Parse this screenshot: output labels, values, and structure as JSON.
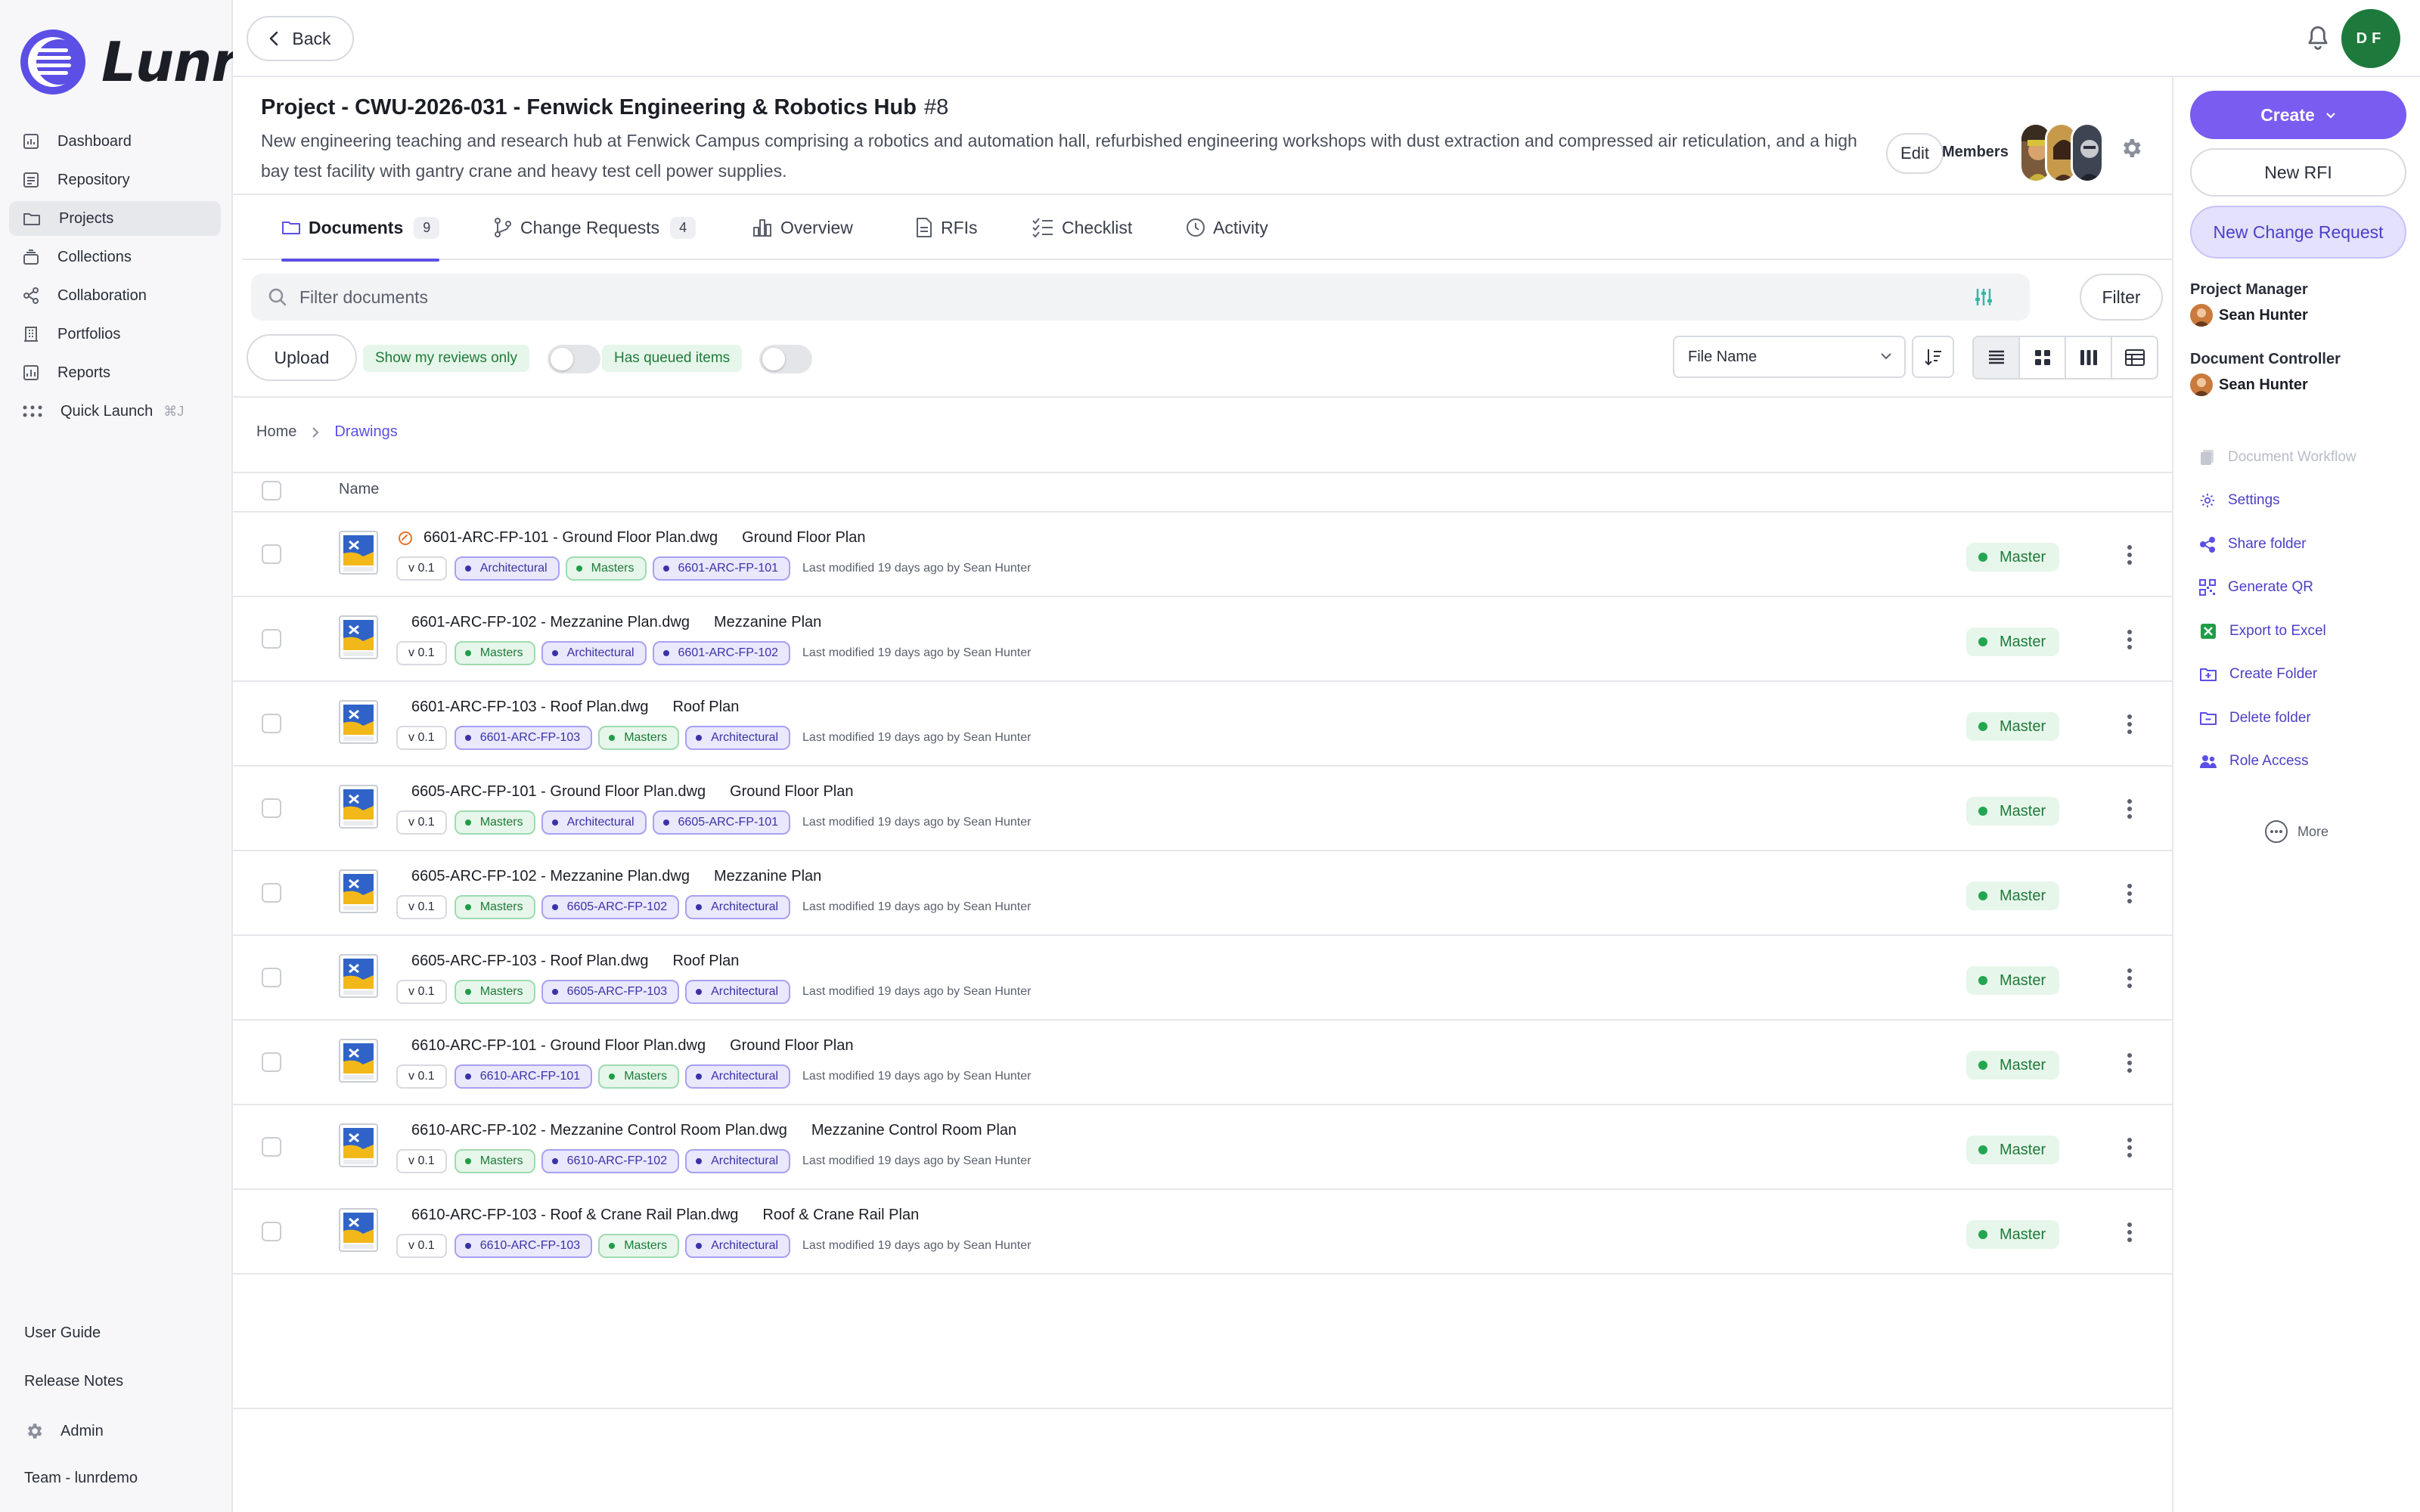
{
  "app": {
    "name": "Lunr"
  },
  "sidebar": {
    "items": [
      {
        "label": "Dashboard",
        "icon": "dashboard-icon"
      },
      {
        "label": "Repository",
        "icon": "repository-icon"
      },
      {
        "label": "Projects",
        "icon": "projects-folder-icon",
        "active": true
      },
      {
        "label": "Collections",
        "icon": "collections-icon"
      },
      {
        "label": "Collaboration",
        "icon": "collaboration-share-icon"
      },
      {
        "label": "Portfolios",
        "icon": "portfolios-building-icon"
      },
      {
        "label": "Reports",
        "icon": "reports-chart-icon"
      },
      {
        "label": "Quick Launch",
        "icon": "quick-launch-grid-icon",
        "shortcut": "⌘J"
      }
    ],
    "bottom": {
      "user_guide": "User Guide",
      "release_notes": "Release Notes",
      "admin": "Admin",
      "team": "Team - lunrdemo"
    }
  },
  "topbar": {
    "back_label": "Back",
    "user_initials": "DF"
  },
  "project": {
    "title": "Project - CWU-2026-031 - Fenwick Engineering & Robotics Hub",
    "number": "#8",
    "description": "New engineering teaching and research hub at Fenwick Campus comprising a robotics and automation hall, refurbished engineering workshops with dust extraction and compressed air reticulation, and a high bay test facility with gantry crane and heavy test cell power supplies.",
    "edit_label": "Edit",
    "members_label": "Members"
  },
  "tabs": [
    {
      "label": "Documents",
      "count": "9",
      "active": true
    },
    {
      "label": "Change Requests",
      "count": "4"
    },
    {
      "label": "Overview"
    },
    {
      "label": "RFIs"
    },
    {
      "label": "Checklist"
    },
    {
      "label": "Activity"
    }
  ],
  "filter": {
    "placeholder": "Filter documents",
    "button_label": "Filter"
  },
  "toolbar": {
    "upload_label": "Upload",
    "reviews_only_label": "Show my reviews only",
    "queued_label": "Has queued items",
    "sort_field": "File Name"
  },
  "breadcrumb": {
    "home": "Home",
    "current": "Drawings"
  },
  "table": {
    "name_header": "Name",
    "rows": [
      {
        "file": "6601-ARC-FP-101 - Ground Floor Plan.dwg",
        "title": "Ground Floor Plan",
        "version": "v 0.1",
        "tags": [
          {
            "text": "Architectural",
            "style": "purple"
          },
          {
            "text": "Masters",
            "style": "green"
          },
          {
            "text": "6601-ARC-FP-101",
            "style": "purple"
          }
        ],
        "modified": "Last modified 19 days ago by Sean Hunter",
        "status": "Master",
        "linked": true
      },
      {
        "file": "6601-ARC-FP-102 - Mezzanine Plan.dwg",
        "title": "Mezzanine Plan",
        "version": "v 0.1",
        "tags": [
          {
            "text": "Masters",
            "style": "green"
          },
          {
            "text": "Architectural",
            "style": "purple"
          },
          {
            "text": "6601-ARC-FP-102",
            "style": "purple"
          }
        ],
        "modified": "Last modified 19 days ago by Sean Hunter",
        "status": "Master"
      },
      {
        "file": "6601-ARC-FP-103 - Roof Plan.dwg",
        "title": "Roof Plan",
        "version": "v 0.1",
        "tags": [
          {
            "text": "6601-ARC-FP-103",
            "style": "purple"
          },
          {
            "text": "Masters",
            "style": "green"
          },
          {
            "text": "Architectural",
            "style": "purple"
          }
        ],
        "modified": "Last modified 19 days ago by Sean Hunter",
        "status": "Master"
      },
      {
        "file": "6605-ARC-FP-101 - Ground Floor Plan.dwg",
        "title": "Ground Floor Plan",
        "version": "v 0.1",
        "tags": [
          {
            "text": "Masters",
            "style": "green"
          },
          {
            "text": "Architectural",
            "style": "purple"
          },
          {
            "text": "6605-ARC-FP-101",
            "style": "purple"
          }
        ],
        "modified": "Last modified 19 days ago by Sean Hunter",
        "status": "Master"
      },
      {
        "file": "6605-ARC-FP-102 - Mezzanine Plan.dwg",
        "title": "Mezzanine Plan",
        "version": "v 0.1",
        "tags": [
          {
            "text": "Masters",
            "style": "green"
          },
          {
            "text": "6605-ARC-FP-102",
            "style": "purple"
          },
          {
            "text": "Architectural",
            "style": "purple"
          }
        ],
        "modified": "Last modified 19 days ago by Sean Hunter",
        "status": "Master"
      },
      {
        "file": "6605-ARC-FP-103 - Roof Plan.dwg",
        "title": "Roof Plan",
        "version": "v 0.1",
        "tags": [
          {
            "text": "Masters",
            "style": "green"
          },
          {
            "text": "6605-ARC-FP-103",
            "style": "purple"
          },
          {
            "text": "Architectural",
            "style": "purple"
          }
        ],
        "modified": "Last modified 19 days ago by Sean Hunter",
        "status": "Master"
      },
      {
        "file": "6610-ARC-FP-101 - Ground Floor Plan.dwg",
        "title": "Ground Floor Plan",
        "version": "v 0.1",
        "tags": [
          {
            "text": "6610-ARC-FP-101",
            "style": "purple"
          },
          {
            "text": "Masters",
            "style": "green"
          },
          {
            "text": "Architectural",
            "style": "purple"
          }
        ],
        "modified": "Last modified 19 days ago by Sean Hunter",
        "status": "Master"
      },
      {
        "file": "6610-ARC-FP-102 - Mezzanine Control Room Plan.dwg",
        "title": "Mezzanine Control Room Plan",
        "version": "v 0.1",
        "tags": [
          {
            "text": "Masters",
            "style": "green"
          },
          {
            "text": "6610-ARC-FP-102",
            "style": "purple"
          },
          {
            "text": "Architectural",
            "style": "purple"
          }
        ],
        "modified": "Last modified 19 days ago by Sean Hunter",
        "status": "Master"
      },
      {
        "file": "6610-ARC-FP-103 - Roof & Crane Rail Plan.dwg",
        "title": "Roof & Crane Rail Plan",
        "version": "v 0.1",
        "tags": [
          {
            "text": "6610-ARC-FP-103",
            "style": "purple"
          },
          {
            "text": "Masters",
            "style": "green"
          },
          {
            "text": "Architectural",
            "style": "purple"
          }
        ],
        "modified": "Last modified 19 days ago by Sean Hunter",
        "status": "Master"
      }
    ]
  },
  "right_panel": {
    "create_label": "Create",
    "new_rfi_label": "New RFI",
    "new_cr_label": "New Change Request",
    "project_manager_label": "Project Manager",
    "project_manager": "Sean Hunter",
    "document_controller_label": "Document Controller",
    "document_controller": "Sean Hunter",
    "actions": [
      {
        "label": "Document Workflow",
        "icon": "workflow-icon",
        "disabled": true
      },
      {
        "label": "Settings",
        "icon": "settings-gear-icon"
      },
      {
        "label": "Share folder",
        "icon": "share-icon"
      },
      {
        "label": "Generate QR",
        "icon": "qr-code-icon"
      },
      {
        "label": "Export to Excel",
        "icon": "excel-icon"
      },
      {
        "label": "Create Folder",
        "icon": "create-folder-icon"
      },
      {
        "label": "Delete folder",
        "icon": "delete-folder-icon"
      },
      {
        "label": "Role Access",
        "icon": "role-access-users-icon"
      }
    ],
    "more_label": "More"
  },
  "colors": {
    "accent": "#5b4fe6",
    "create_button": "#7a5cf0",
    "master_green": "#22a652",
    "avatar": "#1e7a3c"
  }
}
